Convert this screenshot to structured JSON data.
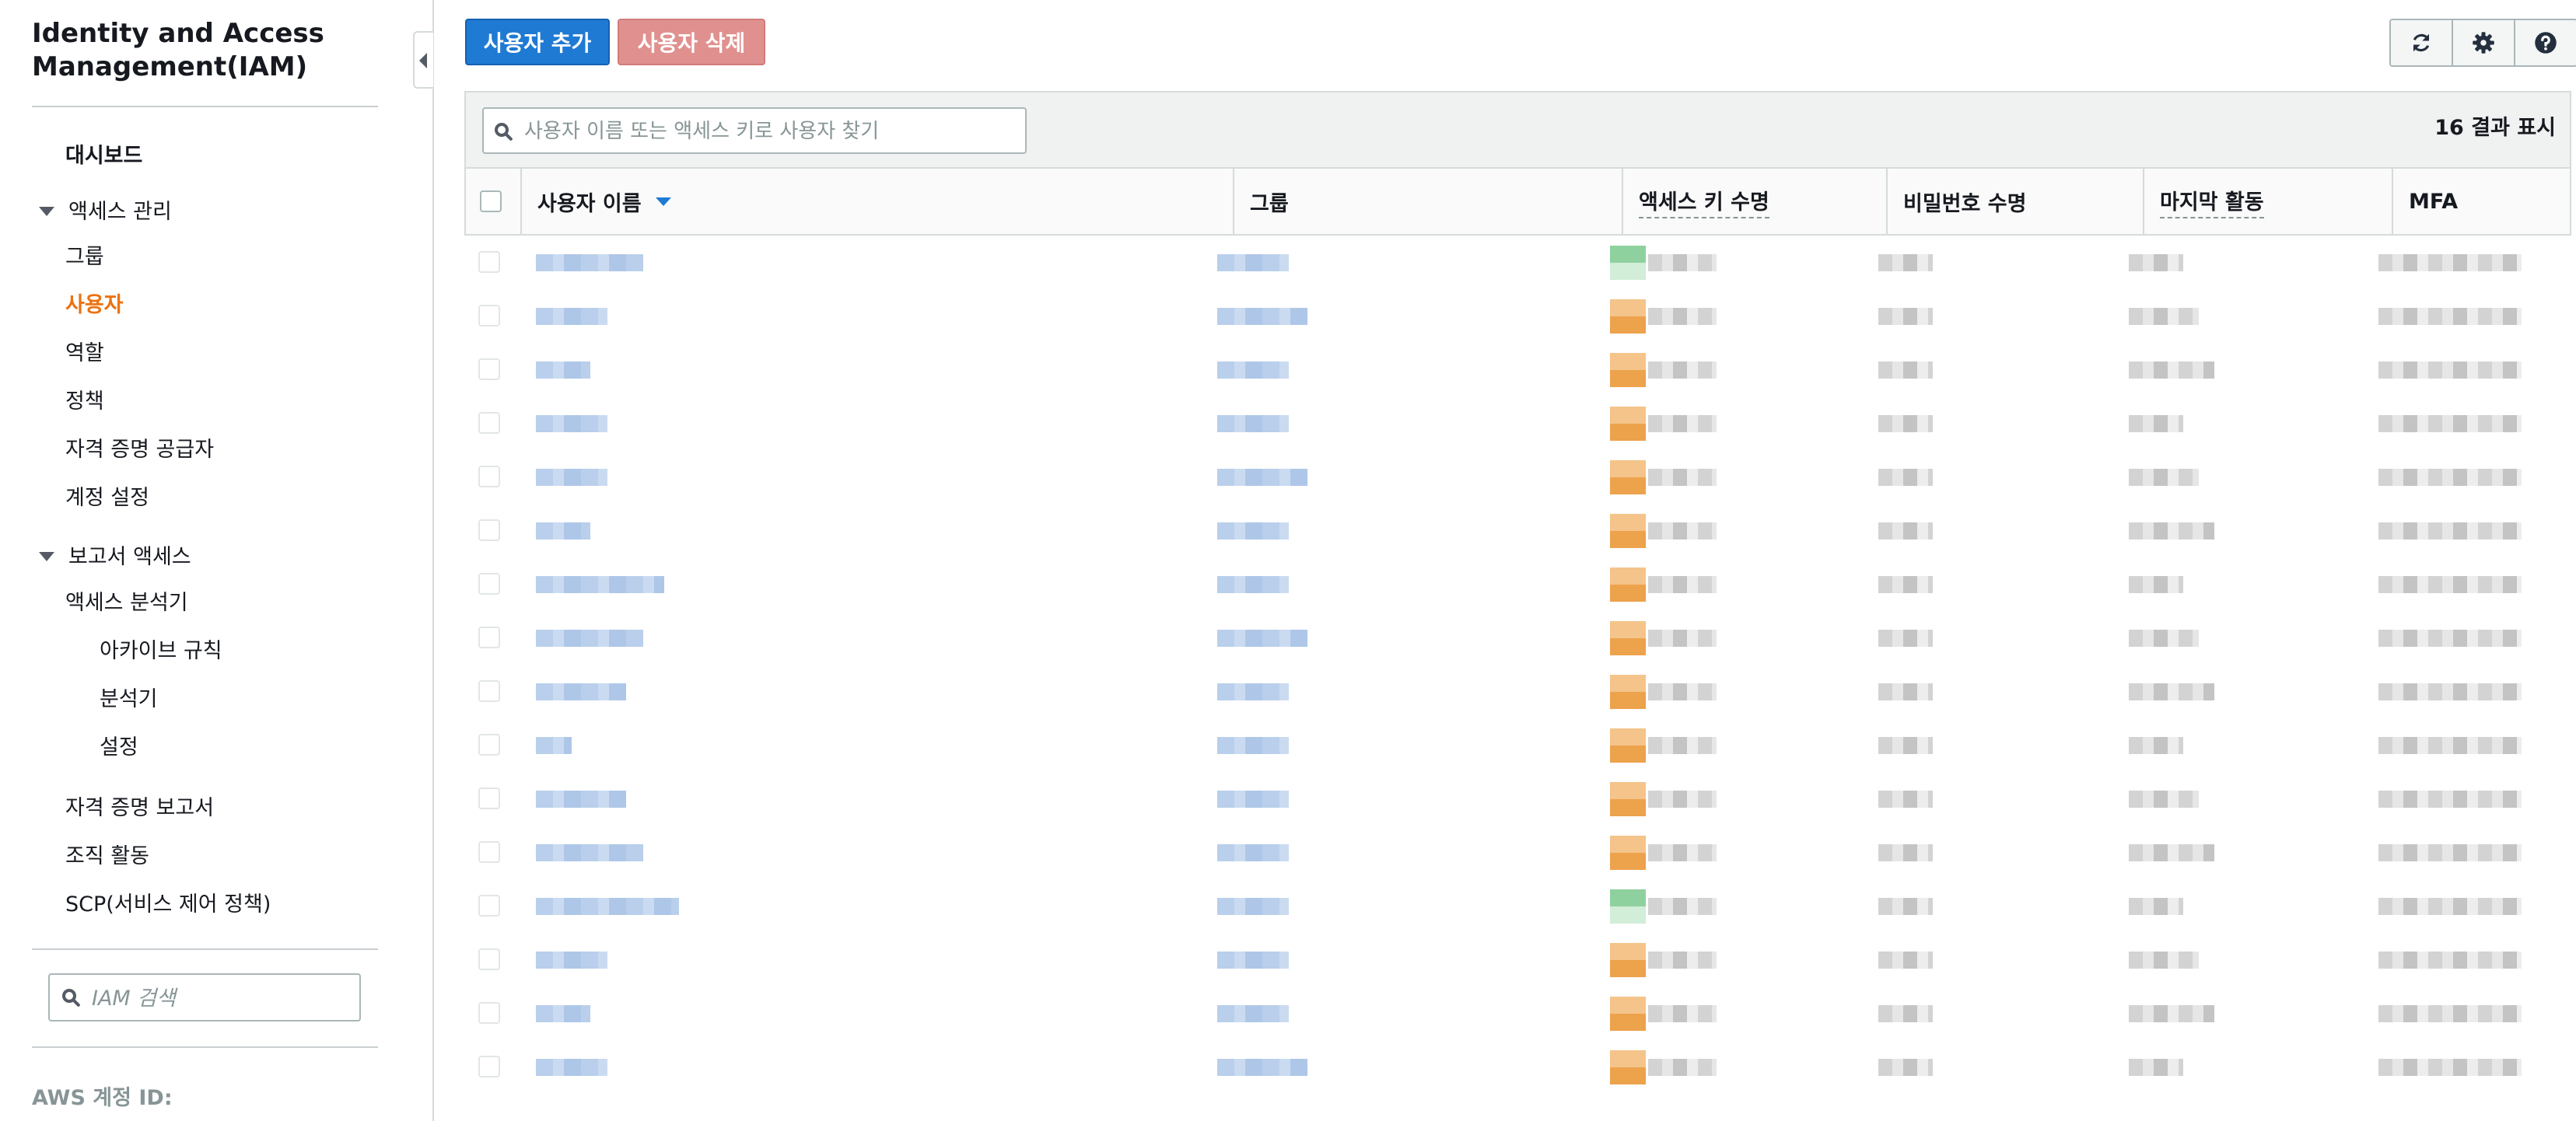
{
  "sidebar": {
    "title": "Identity and Access Management(IAM)",
    "dashboard": "대시보드",
    "access_management": {
      "label": "액세스 관리",
      "items": [
        "그룹",
        "사용자",
        "역할",
        "정책",
        "자격 증명 공급자",
        "계정 설정"
      ],
      "active": "사용자"
    },
    "reports": {
      "label": "보고서 액세스",
      "analyzer": "액세스 분석기",
      "analyzer_items": [
        "아카이브 규칙",
        "분석기",
        "설정"
      ],
      "items": [
        "자격 증명 보고서",
        "조직 활동",
        "SCP(서비스 제어 정책)"
      ]
    },
    "search_placeholder": "IAM 검색",
    "account_id_label": "AWS 계정 ID:"
  },
  "toolbar": {
    "add_user": "사용자 추가",
    "delete_user": "사용자 삭제",
    "search_placeholder": "사용자 이름 또는 액세스 키로 사용자 찾기",
    "result_count": "16 결과 표시",
    "icons": [
      "refresh-icon",
      "gear-icon",
      "help-icon"
    ]
  },
  "table": {
    "columns": [
      "사용자 이름",
      "그룹",
      "액세스 키 수명",
      "비밀번호 수명",
      "마지막 활동",
      "MFA"
    ],
    "sorted_column": "사용자 이름",
    "sort_direction": "ascending",
    "row_count": 16,
    "rows_redacted": true,
    "access_key_status": [
      "green",
      "orange",
      "orange",
      "orange",
      "orange",
      "orange",
      "orange",
      "orange",
      "orange",
      "orange",
      "orange",
      "orange",
      "green",
      "orange",
      "orange",
      "orange"
    ],
    "colors": {
      "warning": "#eda24c",
      "ok": "#5cb85c",
      "primary": "#1f7ad3",
      "active_nav": "#ec7211"
    }
  }
}
